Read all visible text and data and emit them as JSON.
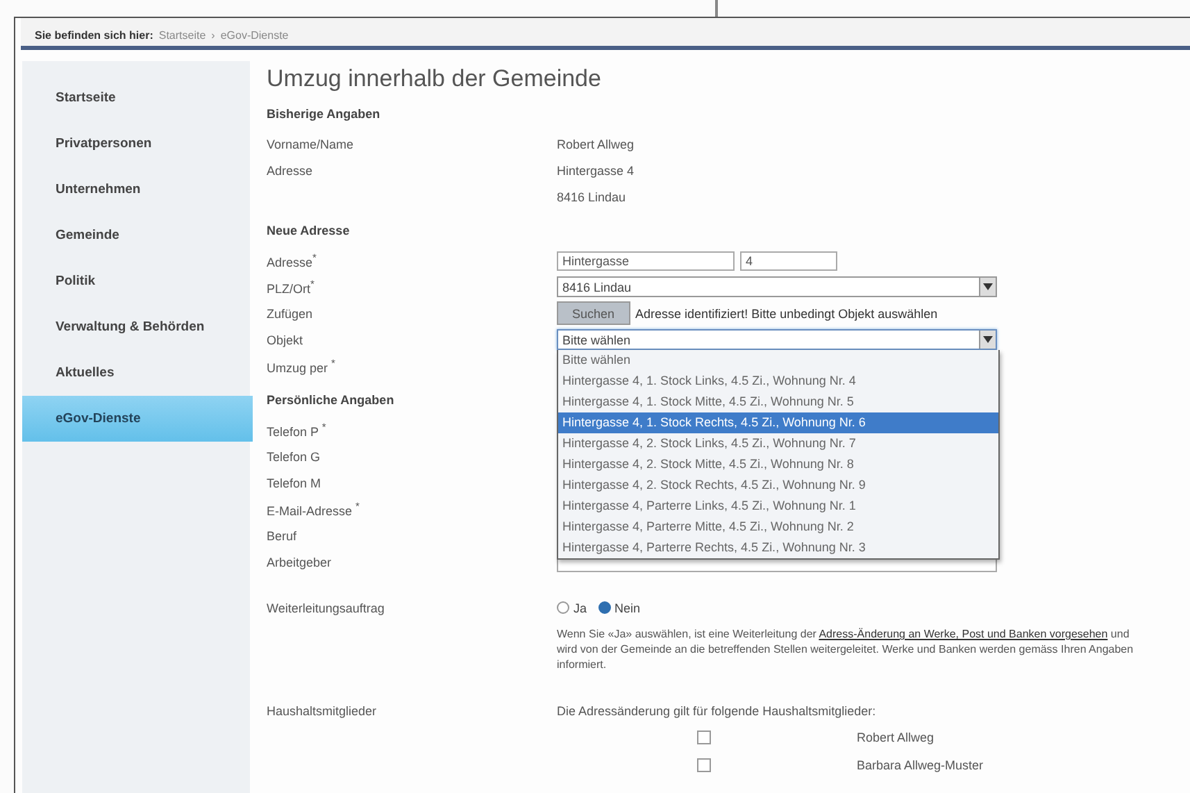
{
  "breadcrumb": {
    "prefix": "Sie befinden sich hier:",
    "links": [
      "Startseite",
      "eGov-Dienste"
    ],
    "separator": "›"
  },
  "sidebar": {
    "items": [
      {
        "label": "Startseite",
        "selected": false
      },
      {
        "label": "Privatpersonen",
        "selected": false
      },
      {
        "label": "Unternehmen",
        "selected": false
      },
      {
        "label": "Gemeinde",
        "selected": false
      },
      {
        "label": "Politik",
        "selected": false
      },
      {
        "label": "Verwaltung & Behörden",
        "selected": false
      },
      {
        "label": "Aktuelles",
        "selected": false
      },
      {
        "label": "eGov-Dienste",
        "selected": true
      }
    ]
  },
  "title": "Umzug innerhalb der Gemeinde",
  "bisherige": {
    "heading": "Bisherige Angaben",
    "rows": [
      {
        "label": "Vorname/Name",
        "value": "Robert Allweg"
      },
      {
        "label": "Adresse",
        "value": "Hintergasse 4"
      },
      {
        "label": "",
        "value": "8416 Lindau"
      }
    ]
  },
  "neue_adresse": {
    "heading": "Neue Adresse",
    "rows": [
      {
        "kind": "address",
        "label": "Adresse$^{*}$",
        "street": "Hintergasse",
        "number": "4"
      },
      {
        "kind": "select",
        "label": "PLZ/Ort$^{*}$",
        "value": "8416 Lindau",
        "focused": false
      },
      {
        "kind": "button",
        "label": "Zufügen",
        "button": "Suchen",
        "note": "Adresse identifiziert! Bitte unbedingt Objekt auswählen"
      },
      {
        "kind": "select",
        "label": "Objekt",
        "value": "Bitte wählen",
        "focused": true,
        "expanded": true,
        "options": [
          {
            "label": "Bitte wählen",
            "highlighted": false
          },
          {
            "label": "Hintergasse 4, 1. Stock Links, 4.5 Zi., Wohnung Nr. 4",
            "highlighted": false
          },
          {
            "label": "Hintergasse 4, 1. Stock Mitte, 4.5 Zi., Wohnung Nr. 5",
            "highlighted": false
          },
          {
            "label": "Hintergasse 4, 1. Stock Rechts, 4.5 Zi., Wohnung Nr. 6",
            "highlighted": true
          },
          {
            "label": "Hintergasse 4, 2. Stock Links, 4.5 Zi., Wohnung Nr. 7",
            "highlighted": false
          },
          {
            "label": "Hintergasse 4, 2. Stock Mitte, 4.5 Zi., Wohnung Nr. 8",
            "highlighted": false
          },
          {
            "label": "Hintergasse 4, 2. Stock Rechts, 4.5 Zi., Wohnung Nr. 9",
            "highlighted": false
          },
          {
            "label": "Hintergasse 4, Parterre Links, 4.5 Zi., Wohnung Nr. 1",
            "highlighted": false
          },
          {
            "label": "Hintergasse 4, Parterre Mitte, 4.5 Zi., Wohnung Nr. 2",
            "highlighted": false
          },
          {
            "label": "Hintergasse 4, Parterre Rechts, 4.5 Zi., Wohnung Nr. 3",
            "highlighted": false
          }
        ]
      },
      {
        "kind": "covered",
        "label": "Umzug per $^{*}$"
      }
    ]
  },
  "persoenlich": {
    "heading": "Persönliche Angaben",
    "rows": [
      {
        "kind": "covered",
        "label": "Telefon P $^{*}$"
      },
      {
        "kind": "covered",
        "label": "Telefon G"
      },
      {
        "kind": "covered",
        "label": "Telefon M"
      },
      {
        "kind": "covered",
        "label": "E-Mail-Adresse $^{*}$"
      },
      {
        "kind": "covered",
        "label": "Beruf"
      },
      {
        "kind": "input",
        "label": "Arbeitgeber"
      }
    ]
  },
  "weiterleitung": {
    "label": "Weiterleitungsauftrag",
    "options": [
      {
        "label": "Ja",
        "selected": false
      },
      {
        "label": "Nein",
        "selected": true
      }
    ],
    "note_before": "Wenn Sie «Ja» auswählen, ist eine Weiterleitung der",
    "note_link": "Adress-Änderung an Werke, Post und Banken vorgesehen",
    "note_after": "und wird von der Gemeinde an die betreffenden Stellen weitergeleitet. Werke und Banken werden gemäss Ihren Angaben informiert."
  },
  "haushalt": {
    "label": "Haushaltsmitglieder",
    "intro": "Die Adressänderung gilt für folgende Haushaltsmitglieder:",
    "members": [
      {
        "name": "Robert Allweg",
        "checked": false
      },
      {
        "name": "Barbara Allweg-Muster",
        "checked": false
      }
    ]
  }
}
